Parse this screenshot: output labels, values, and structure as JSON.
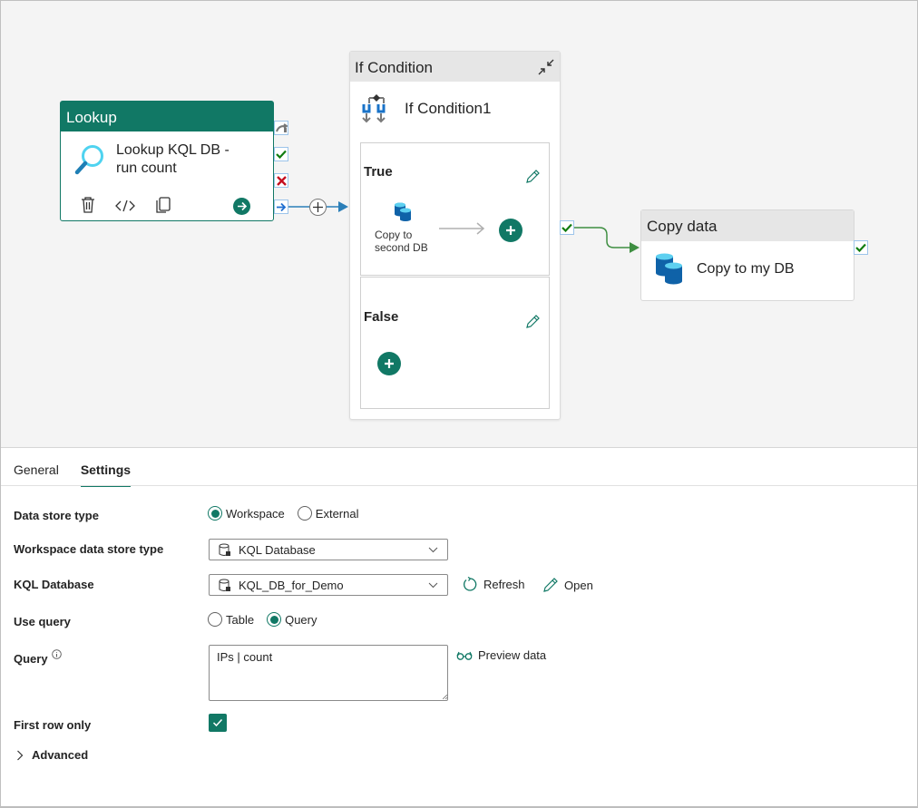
{
  "canvas": {
    "lookup": {
      "type_label": "Lookup",
      "name": "Lookup KQL DB - run count",
      "toolbar": [
        "delete-icon",
        "code-icon",
        "copy-icon",
        "go-icon"
      ],
      "ports": [
        "skip",
        "success",
        "failure",
        "completion"
      ]
    },
    "if_condition": {
      "type_label": "If Condition",
      "name": "If Condition1",
      "true_branch": {
        "label": "True",
        "activity": "Copy to second DB"
      },
      "false_branch": {
        "label": "False"
      }
    },
    "copy_data": {
      "type_label": "Copy data",
      "name": "Copy to my DB"
    }
  },
  "panel": {
    "tabs": [
      {
        "label": "General",
        "active": false
      },
      {
        "label": "Settings",
        "active": true
      }
    ],
    "fields": {
      "data_store_type": {
        "label": "Data store type",
        "options": [
          "Workspace",
          "External"
        ],
        "selected": "Workspace"
      },
      "workspace_data_store_type": {
        "label": "Workspace data store type",
        "value": "KQL Database"
      },
      "kql_database": {
        "label": "KQL Database",
        "value": "KQL_DB_for_Demo",
        "refresh_label": "Refresh",
        "open_label": "Open"
      },
      "use_query": {
        "label": "Use query",
        "options": [
          "Table",
          "Query"
        ],
        "selected": "Query"
      },
      "query": {
        "label": "Query",
        "value": "IPs | count",
        "preview_label": "Preview data"
      },
      "first_row_only": {
        "label": "First row only",
        "checked": true
      },
      "advanced": {
        "label": "Advanced"
      }
    }
  },
  "colors": {
    "accent": "#117865",
    "canvas_bg": "#f4f4f4",
    "header_gray": "#e6e6e6",
    "success": "#107c10",
    "failure": "#c50f1f",
    "connector_blue": "#1f77b4",
    "connector_green": "#3e8e41"
  }
}
